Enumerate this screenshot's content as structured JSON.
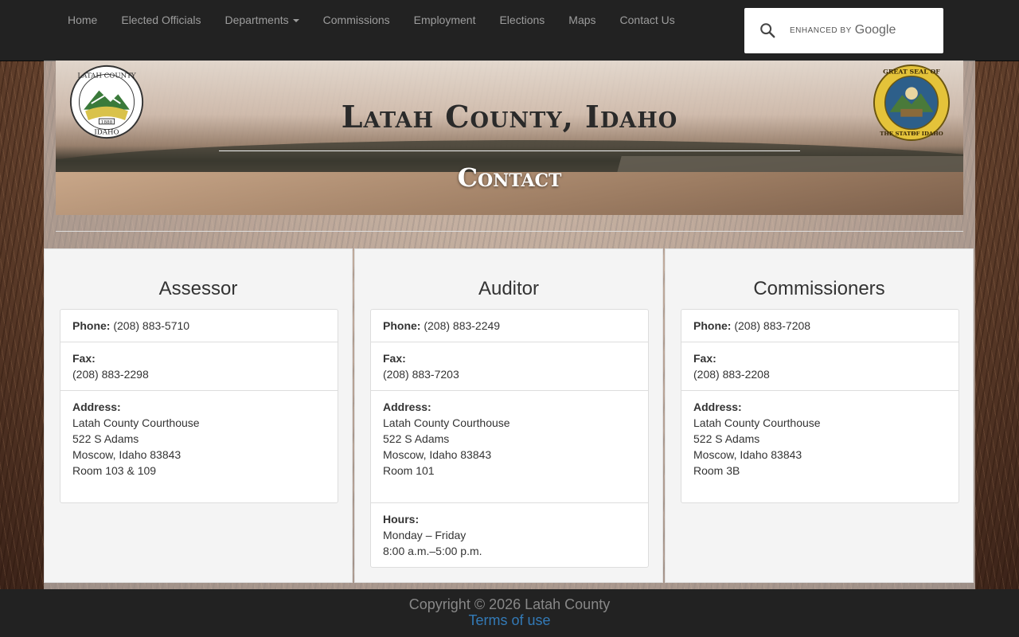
{
  "nav": {
    "items": [
      "Home",
      "Elected Officials",
      "Departments",
      "Commissions",
      "Employment",
      "Elections",
      "Maps",
      "Contact Us"
    ],
    "search": {
      "enhanced_by": "ENHANCED BY",
      "google": "Google",
      "placeholder": ""
    }
  },
  "banner": {
    "title": "Latah County, Idaho",
    "subtitle": "Contact",
    "left_seal_text": [
      "LATAH COUNTY",
      "1888",
      "IDAHO"
    ],
    "right_seal_text": [
      "GREAT SEAL OF",
      "THE STATE",
      "OF IDAHO"
    ]
  },
  "columns": [
    {
      "title": "Assessor",
      "phone_label": "Phone:",
      "phone": "(208) 883-5710",
      "fax_label": "Fax:",
      "fax": "(208) 883-2298",
      "address_label": "Address:",
      "address": [
        "Latah County Courthouse",
        "522 S Adams",
        "Moscow, Idaho 83843",
        "Room 103 & 109"
      ]
    },
    {
      "title": "Auditor",
      "phone_label": "Phone:",
      "phone": "(208) 883-2249",
      "fax_label": "Fax:",
      "fax": "(208) 883-7203",
      "address_label": "Address:",
      "address": [
        "Latah County Courthouse",
        "522 S Adams",
        "Moscow, Idaho 83843",
        "Room 101"
      ],
      "hours_label": "Hours:",
      "hours": [
        "Monday – Friday",
        "8:00 a.m.–5:00 p.m."
      ]
    },
    {
      "title": "Commissioners",
      "phone_label": "Phone:",
      "phone": "(208) 883-7208",
      "fax_label": "Fax:",
      "fax": "(208) 883-2208",
      "address_label": "Address:",
      "address": [
        "Latah County Courthouse",
        "522 S Adams",
        "Moscow, Idaho 83843",
        "Room 3B"
      ]
    }
  ],
  "footer": {
    "copyright": "Copyright © 2026 Latah County",
    "terms": "Terms of use"
  },
  "colors": {
    "navbar": "#222222",
    "nav_text": "#9d9d9d",
    "link": "#337ab7",
    "footer": "#222222"
  }
}
